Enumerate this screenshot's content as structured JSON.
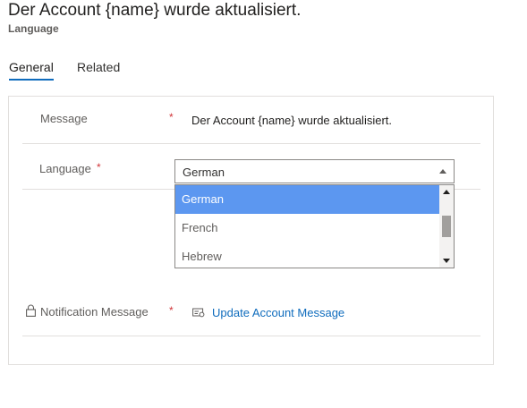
{
  "header": {
    "title": "Der Account {name} wurde aktualisiert.",
    "subtitle": "Language"
  },
  "tabs": [
    {
      "label": "General",
      "active": true
    },
    {
      "label": "Related",
      "active": false
    }
  ],
  "form": {
    "message": {
      "label": "Message",
      "required_mark": "*",
      "value": "Der Account {name} wurde aktualisiert."
    },
    "language": {
      "label": "Language",
      "required_mark": "*",
      "selected": "German",
      "options": [
        "German",
        "French",
        "Hebrew"
      ],
      "highlighted_option": "German"
    },
    "notification": {
      "label": "Notification Message",
      "required_mark": "*",
      "value": "Update Account Message",
      "icon": "lock-icon",
      "link_icon": "entity-record-icon"
    }
  },
  "colors": {
    "accent": "#0f6cbd",
    "required": "#d13438",
    "highlight": "#5c97f0"
  }
}
